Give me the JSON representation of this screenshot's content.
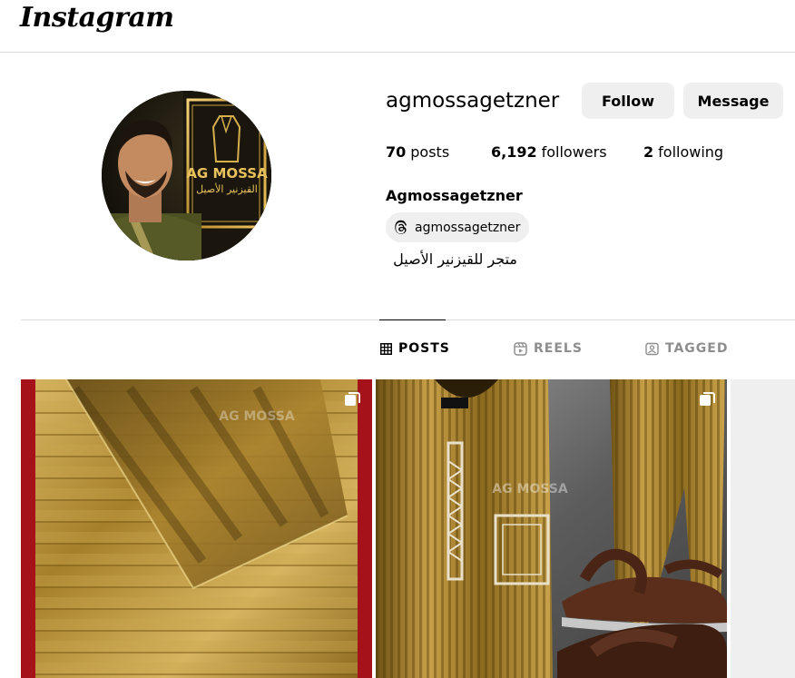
{
  "app": {
    "logo_text": "Instagram"
  },
  "profile": {
    "username": "agmossagetzner",
    "full_name": "Agmossagetzner",
    "threads_handle": "agmossagetzner",
    "bio": "متجر للقيزنير الأصيل",
    "avatar_overlay_text": "AG MOSSA",
    "avatar_overlay_subtext": "القيزنير الأصيل"
  },
  "actions": {
    "follow_label": "Follow",
    "message_label": "Message"
  },
  "stats": {
    "posts_count": "70",
    "posts_label": "posts",
    "followers_count": "6,192",
    "followers_label": "followers",
    "following_count": "2",
    "following_label": "following"
  },
  "tabs": [
    {
      "label": "POSTS",
      "icon": "grid-icon",
      "active": true
    },
    {
      "label": "REELS",
      "icon": "reels-icon",
      "active": false
    },
    {
      "label": "TAGGED",
      "icon": "tagged-icon",
      "active": false
    }
  ],
  "posts": [
    {
      "type": "carousel",
      "watermark": "AG MOSSA",
      "icon": "carousel-icon"
    },
    {
      "type": "carousel",
      "watermark": "AG MOSSA",
      "icon": "carousel-icon"
    }
  ]
}
